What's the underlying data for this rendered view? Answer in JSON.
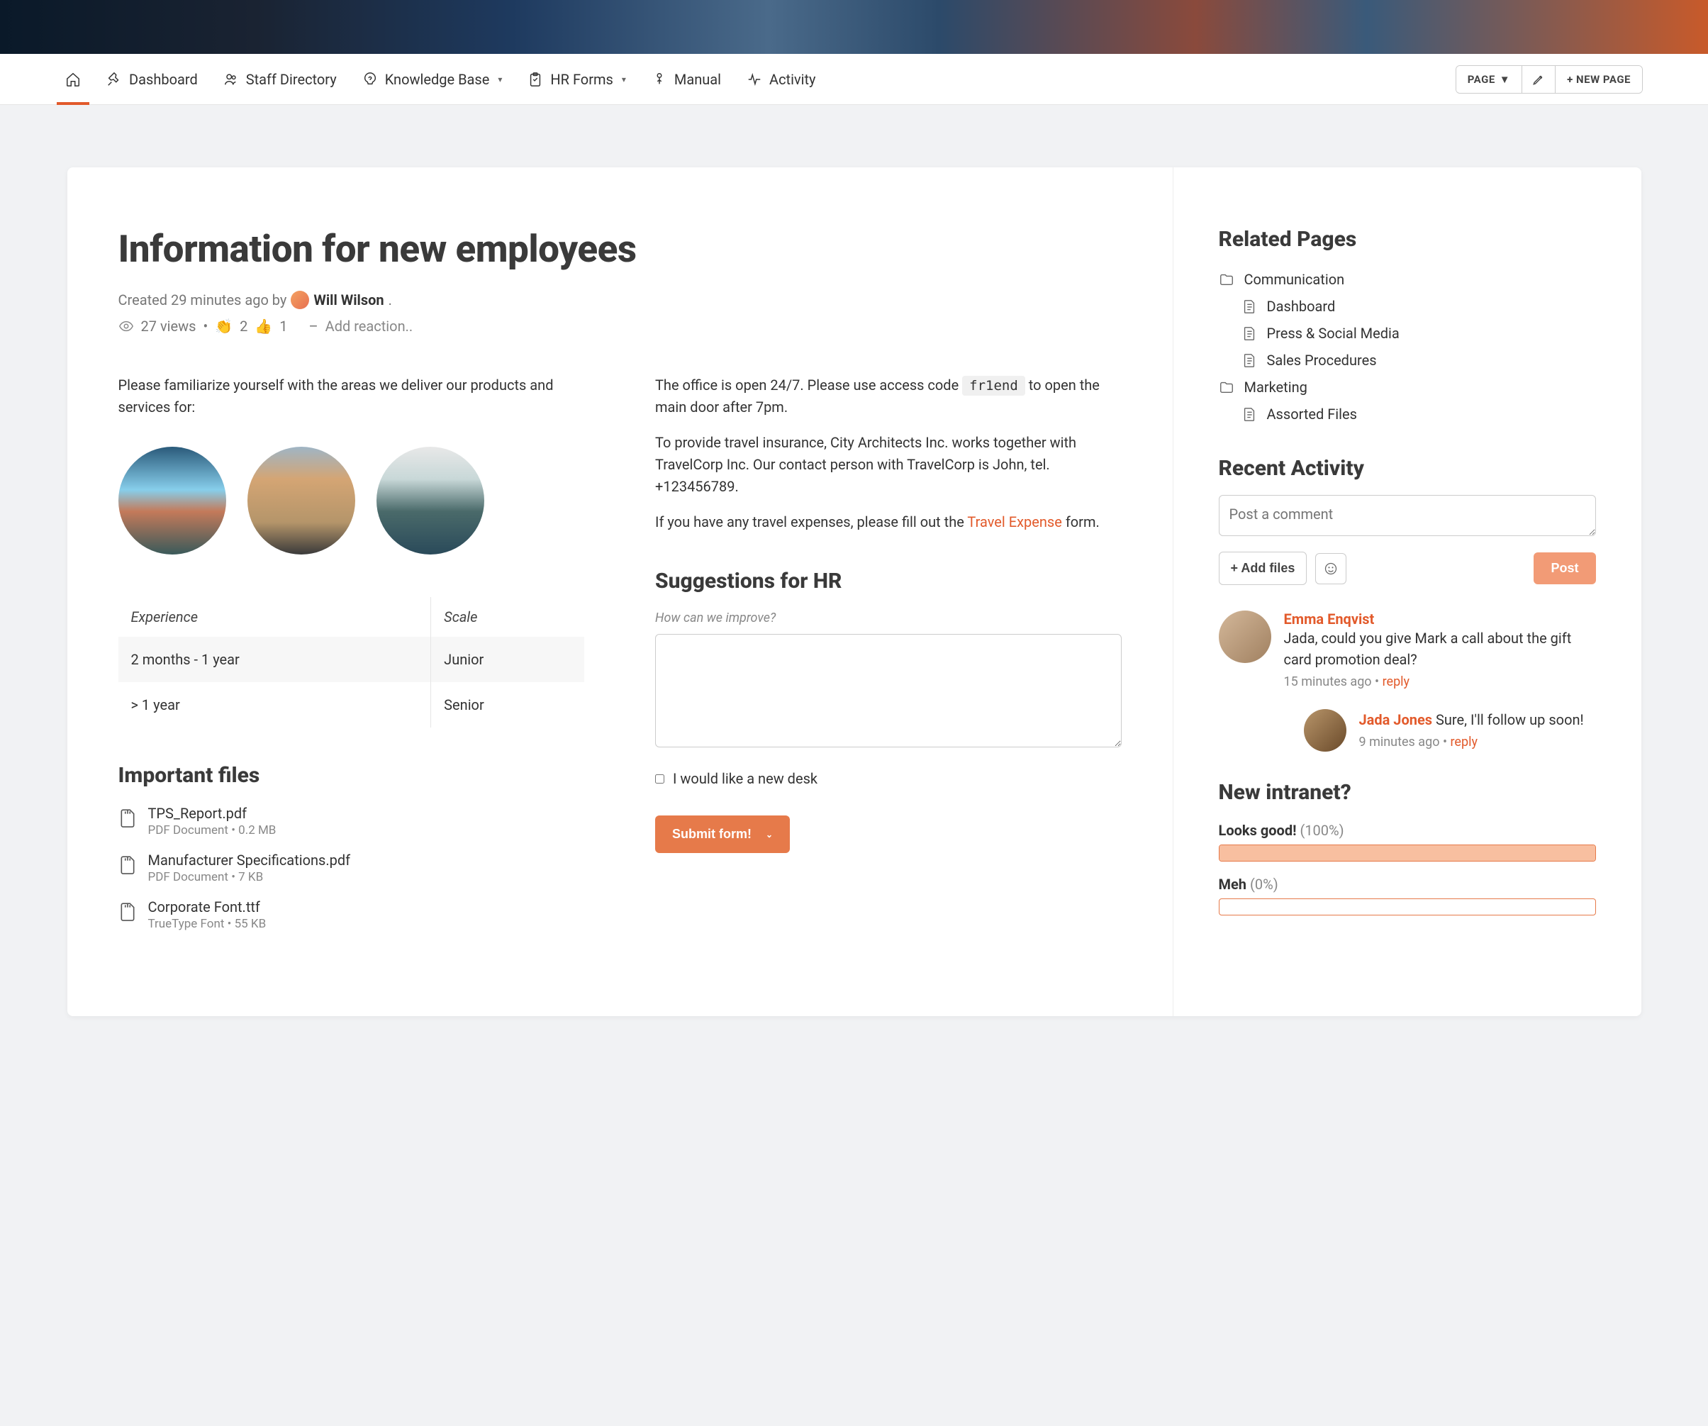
{
  "nav": {
    "dashboard": "Dashboard",
    "staff": "Staff Directory",
    "knowledge": "Knowledge Base",
    "hrforms": "HR Forms",
    "manual": "Manual",
    "activity": "Activity",
    "page_btn": "PAGE",
    "new_page": "+ NEW PAGE"
  },
  "page": {
    "title": "Information for new employees",
    "created_prefix": "Created 29 minutes ago by",
    "author": "Will Wilson",
    "views": "27 views",
    "clap_count": "2",
    "thumbs_count": "1",
    "add_reaction": "Add reaction..",
    "intro_left": "Please familiarize yourself with the areas we deliver our products and services for:",
    "office_text_1": "The office is open 24/7. Please use access code",
    "office_code": "fr1end",
    "office_text_2": "to open the main door after 7pm.",
    "insurance_text": "To provide travel insurance, City Architects Inc. works together with TravelCorp Inc. Our contact person with TravelCorp is John, tel. +123456789.",
    "expense_pre": "If you have any travel expenses, please fill out the",
    "expense_link": "Travel Expense",
    "expense_post": "form."
  },
  "table": {
    "h1": "Experience",
    "h2": "Scale",
    "r1c1": "2 months - 1 year",
    "r1c2": "Junior",
    "r2c1": "> 1 year",
    "r2c2": "Senior"
  },
  "files": {
    "heading": "Important files",
    "items": [
      {
        "name": "TPS_Report.pdf",
        "meta": "PDF Document • 0.2 MB"
      },
      {
        "name": "Manufacturer Specifications.pdf",
        "meta": "PDF Document • 7 KB"
      },
      {
        "name": "Corporate Font.ttf",
        "meta": "TrueType Font • 55 KB"
      }
    ]
  },
  "form": {
    "heading": "Suggestions for HR",
    "label": "How can we improve?",
    "checkbox": "I would like a new desk",
    "submit": "Submit form!"
  },
  "related": {
    "heading": "Related Pages",
    "communication": "Communication",
    "dashboard": "Dashboard",
    "press": "Press & Social Media",
    "sales": "Sales Procedures",
    "marketing": "Marketing",
    "assorted": "Assorted Files"
  },
  "activity": {
    "heading": "Recent Activity",
    "placeholder": "Post a comment",
    "add_files": "+ Add files",
    "post": "Post",
    "c1_name": "Emma Enqvist",
    "c1_text": "Jada, could you give Mark a call about the gift card promotion deal?",
    "c1_time": "15 minutes ago",
    "c2_name": "Jada Jones",
    "c2_text": "Sure, I'll follow up soon!",
    "c2_time": "9 minutes ago",
    "reply": "reply"
  },
  "poll": {
    "heading": "New intranet?",
    "opt1_label": "Looks good!",
    "opt1_pct": "(100%)",
    "opt2_label": "Meh",
    "opt2_pct": "(0%)"
  }
}
